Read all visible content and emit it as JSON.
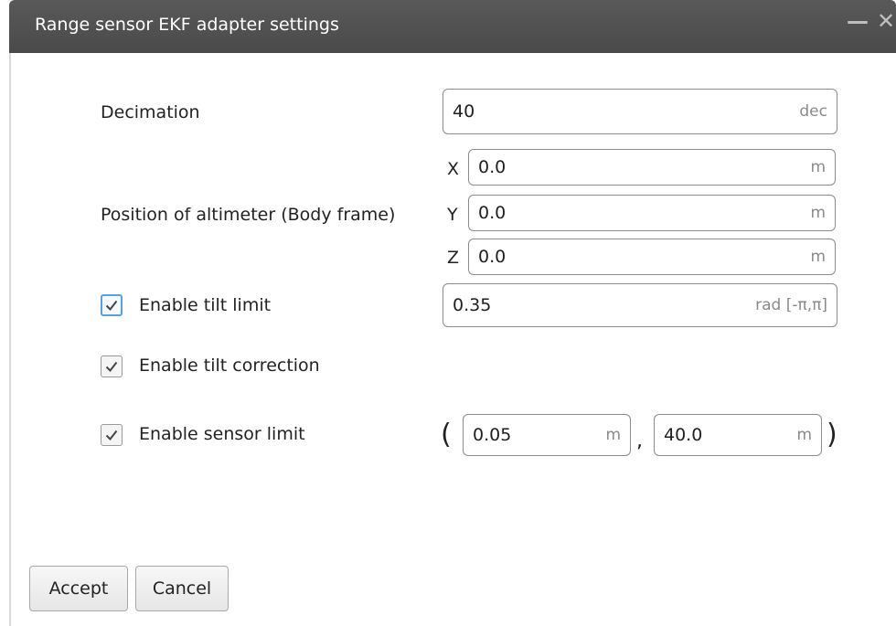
{
  "window": {
    "title": "Range sensor EKF adapter settings",
    "minimize_glyph": "—",
    "close_glyph": "✕"
  },
  "decimation": {
    "label": "Decimation",
    "value": "40",
    "unit": "dec"
  },
  "position": {
    "label": "Position of altimeter (Body frame)",
    "x": {
      "axis": "X",
      "value": "0.0",
      "unit": "m"
    },
    "y": {
      "axis": "Y",
      "value": "0.0",
      "unit": "m"
    },
    "z": {
      "axis": "Z",
      "value": "0.0",
      "unit": "m"
    }
  },
  "tilt_limit": {
    "label": "Enable tilt limit",
    "checked": true,
    "value": "0.35",
    "unit": "rad [-π,π]"
  },
  "tilt_correction": {
    "label": "Enable tilt correction",
    "checked": true
  },
  "sensor_limit": {
    "label": "Enable sensor limit",
    "checked": true,
    "open_paren": "(",
    "min_value": "0.05",
    "min_unit": "m",
    "separator": ",",
    "max_value": "40.0",
    "max_unit": "m",
    "close_paren": ")"
  },
  "buttons": {
    "accept": "Accept",
    "cancel": "Cancel"
  },
  "icons": {
    "checkmark": "checkmark-icon"
  }
}
